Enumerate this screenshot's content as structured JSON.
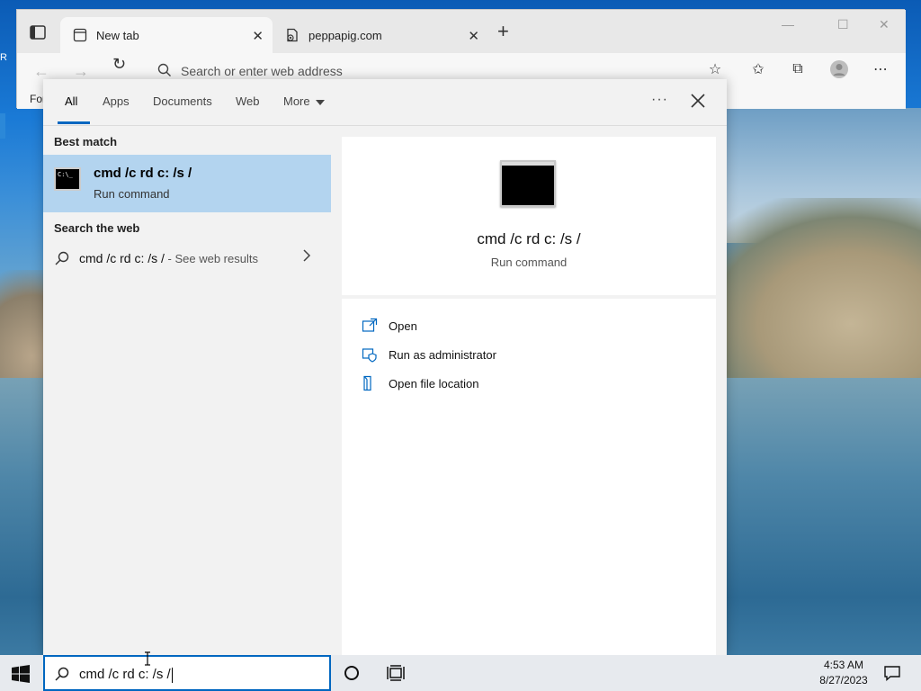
{
  "browser": {
    "tabs": [
      {
        "label": "New tab",
        "active": true
      },
      {
        "label": "peppapig.com",
        "active": false
      }
    ],
    "address_placeholder": "Search or enter web address",
    "favorites_bar_partial": "For"
  },
  "search_panel": {
    "tabs": [
      "All",
      "Apps",
      "Documents",
      "Web",
      "More"
    ],
    "active_tab": "All",
    "best_match_heading": "Best match",
    "best_match": {
      "title": "cmd /c rd c: /s /",
      "subtitle": "Run command"
    },
    "search_web_heading": "Search the web",
    "web_result": {
      "query": "cmd /c rd c: /s /",
      "hint": " - See web results"
    },
    "preview": {
      "title": "cmd /c rd c: /s /",
      "subtitle": "Run command"
    },
    "actions": [
      {
        "label": "Open",
        "icon": "open-icon"
      },
      {
        "label": "Run as administrator",
        "icon": "shield-icon"
      },
      {
        "label": "Open file location",
        "icon": "file-location-icon"
      }
    ]
  },
  "taskbar": {
    "search_value": "cmd /c rd c: /s /",
    "time": "4:53 AM",
    "date": "8/27/2023"
  },
  "colors": {
    "accent": "#0067c0",
    "best_match_highlight": "#b3d4ef",
    "taskbar": "#e7eaee"
  }
}
